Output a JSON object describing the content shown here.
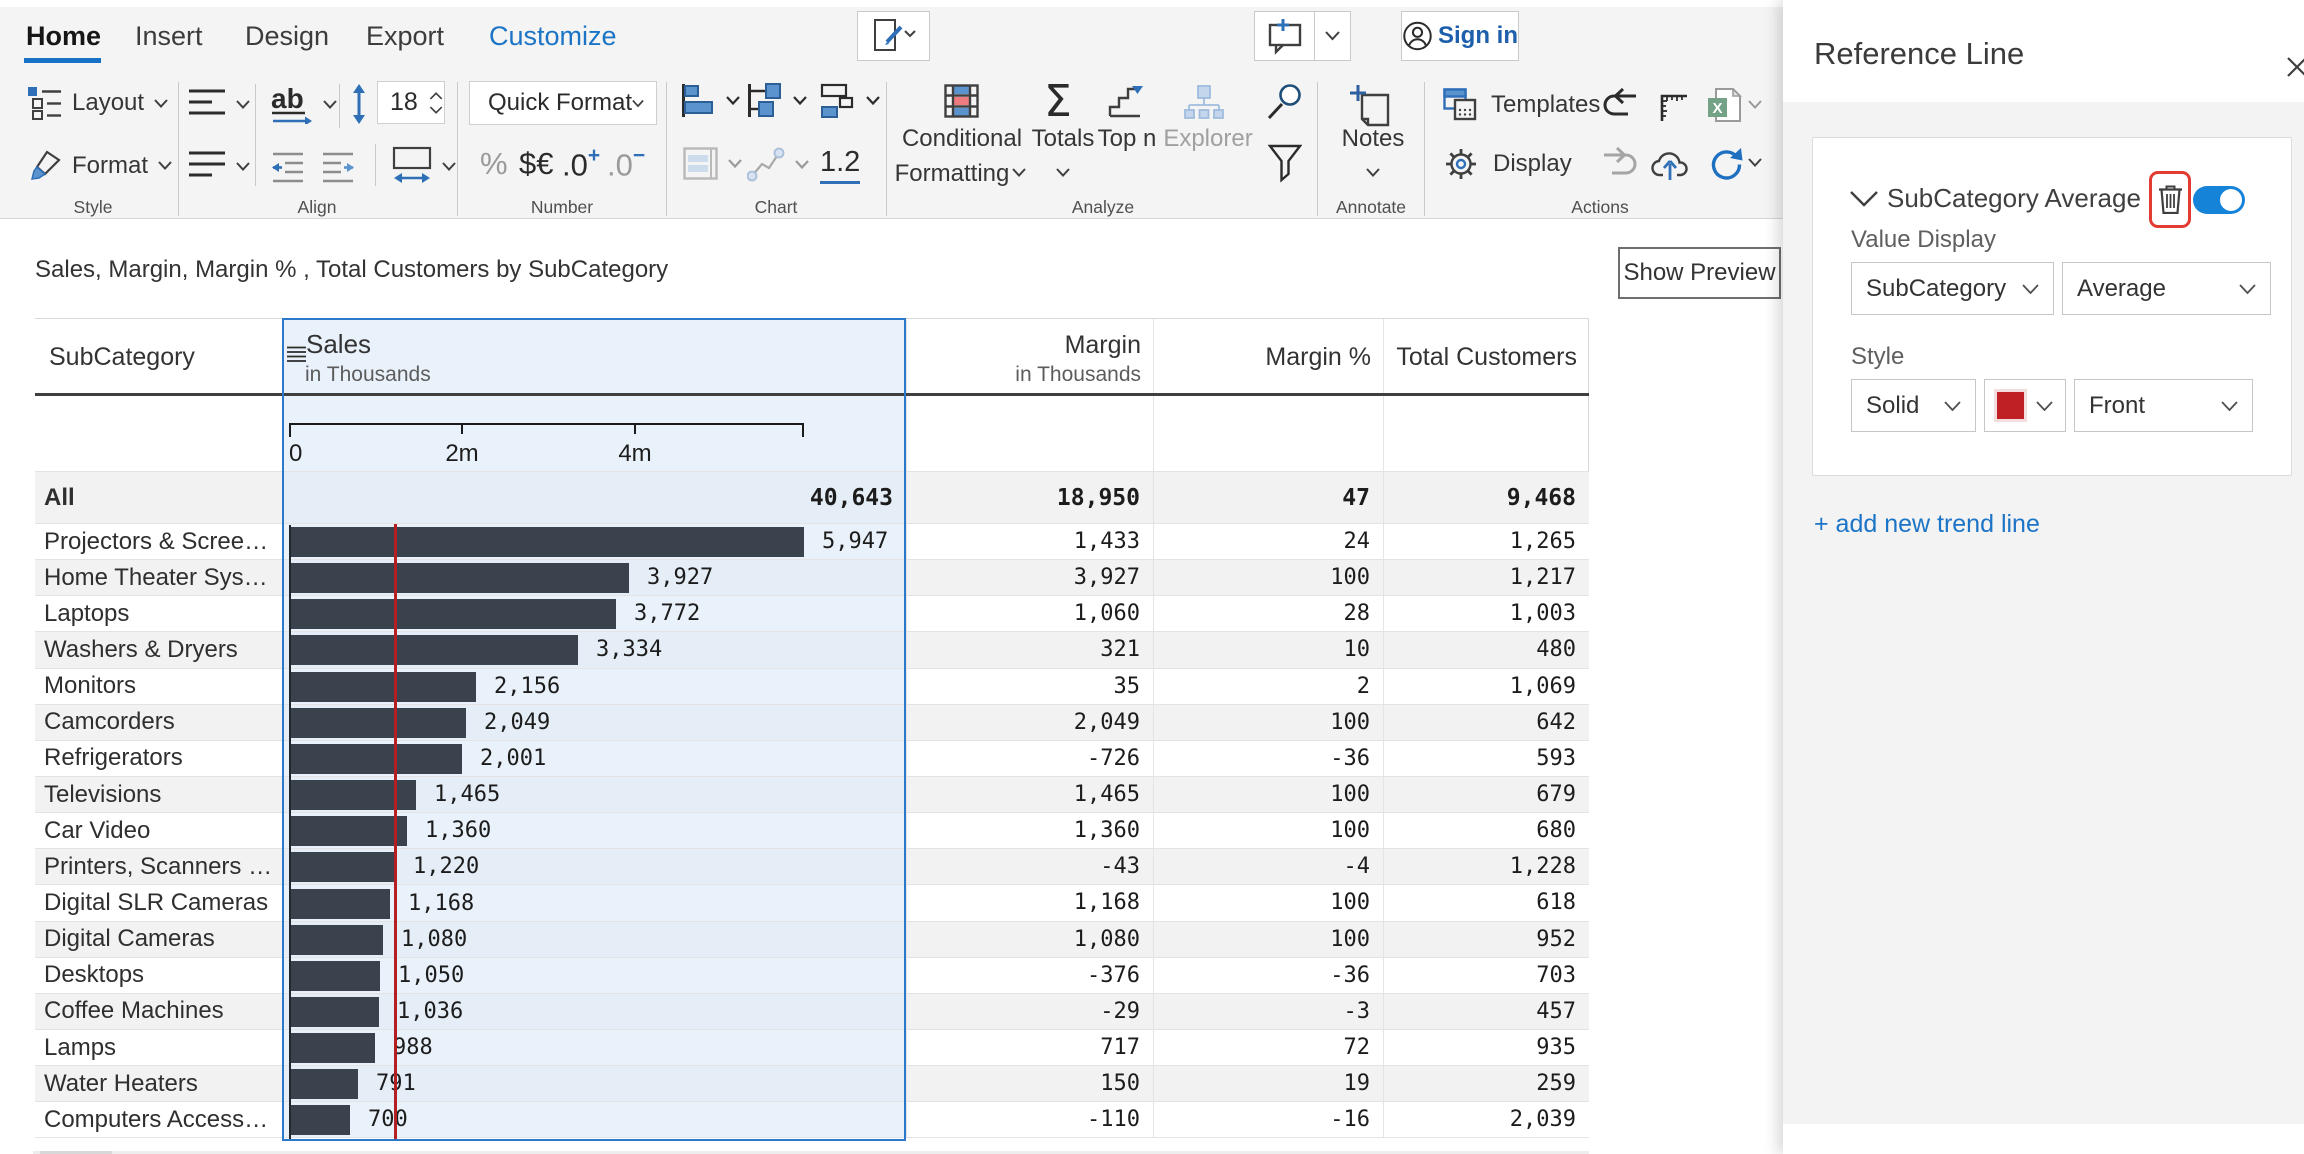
{
  "ribbon": {
    "tabs": [
      {
        "label": "Home",
        "active": true
      },
      {
        "label": "Insert"
      },
      {
        "label": "Design"
      },
      {
        "label": "Export"
      },
      {
        "label": "Customize",
        "highlighted": true
      }
    ],
    "sign_in": "Sign in",
    "style_group": {
      "label": "Style",
      "layout": "Layout",
      "format": "Format"
    },
    "align_group": {
      "label": "Align",
      "font_size": "18"
    },
    "number_group": {
      "label": "Number",
      "quick_format": "Quick Format",
      "percent": "%",
      "currency": "$€",
      "decimal_inc": ".0",
      "decimal_inc_sign": "+",
      "decimal_dec": ".0",
      "decimal_dec_sign": "−"
    },
    "chart_group": {
      "label": "Chart",
      "decimal_icon": "1.2"
    },
    "analyze_group": {
      "label": "Analyze",
      "conditional_line1": "Conditional",
      "conditional_line2": "Formatting",
      "totals": "Totals",
      "top_n": "Top n",
      "explorer": "Explorer"
    },
    "annotate_group": {
      "label": "Annotate",
      "notes": "Notes"
    },
    "actions_group": {
      "label": "Actions",
      "templates": "Templates",
      "display": "Display",
      "excel_letter": "X"
    }
  },
  "toolbar": {
    "title": "Sales, Margin, Margin % , Total Customers by SubCategory",
    "show_preview": "Show Preview"
  },
  "table": {
    "columns": [
      {
        "label": "SubCategory",
        "sub": ""
      },
      {
        "label": "Sales",
        "sub": "in Thousands"
      },
      {
        "label": "Margin",
        "sub": "in Thousands"
      },
      {
        "label": "Margin %",
        "sub": ""
      },
      {
        "label": "Total Customers",
        "sub": ""
      }
    ],
    "total_row": {
      "name": "All",
      "sales": "40,643",
      "margin": "18,950",
      "margin_pct": "47",
      "customers": "9,468"
    },
    "rows": [
      {
        "name": "Projectors & Scree…",
        "sales": "5,947",
        "margin": "1,433",
        "margin_pct": "24",
        "customers": "1,265"
      },
      {
        "name": "Home Theater Sys…",
        "sales": "3,927",
        "margin": "3,927",
        "margin_pct": "100",
        "customers": "1,217"
      },
      {
        "name": "Laptops",
        "sales": "3,772",
        "margin": "1,060",
        "margin_pct": "28",
        "customers": "1,003"
      },
      {
        "name": "Washers & Dryers",
        "sales": "3,334",
        "margin": "321",
        "margin_pct": "10",
        "customers": "480"
      },
      {
        "name": "Monitors",
        "sales": "2,156",
        "margin": "35",
        "margin_pct": "2",
        "customers": "1,069"
      },
      {
        "name": "Camcorders",
        "sales": "2,049",
        "margin": "2,049",
        "margin_pct": "100",
        "customers": "642"
      },
      {
        "name": "Refrigerators",
        "sales": "2,001",
        "margin": "-726",
        "margin_pct": "-36",
        "customers": "593"
      },
      {
        "name": "Televisions",
        "sales": "1,465",
        "margin": "1,465",
        "margin_pct": "100",
        "customers": "679"
      },
      {
        "name": "Car Video",
        "sales": "1,360",
        "margin": "1,360",
        "margin_pct": "100",
        "customers": "680"
      },
      {
        "name": "Printers, Scanners …",
        "sales": "1,220",
        "margin": "-43",
        "margin_pct": "-4",
        "customers": "1,228"
      },
      {
        "name": "Digital SLR Cameras",
        "sales": "1,168",
        "margin": "1,168",
        "margin_pct": "100",
        "customers": "618"
      },
      {
        "name": "Digital Cameras",
        "sales": "1,080",
        "margin": "1,080",
        "margin_pct": "100",
        "customers": "952"
      },
      {
        "name": "Desktops",
        "sales": "1,050",
        "margin": "-376",
        "margin_pct": "-36",
        "customers": "703"
      },
      {
        "name": "Coffee Machines",
        "sales": "1,036",
        "margin": "-29",
        "margin_pct": "-3",
        "customers": "457"
      },
      {
        "name": "Lamps",
        "sales": "988",
        "margin": "717",
        "margin_pct": "72",
        "customers": "935"
      },
      {
        "name": "Water Heaters",
        "sales": "791",
        "margin": "150",
        "margin_pct": "19",
        "customers": "259"
      },
      {
        "name": "Computers Access…",
        "sales": "700",
        "margin": "-110",
        "margin_pct": "-16",
        "customers": "2,039"
      }
    ]
  },
  "chart_data": {
    "type": "bar",
    "orientation": "horizontal",
    "title": "Sales, Margin, Margin % , Total Customers by SubCategory",
    "xlabel": "Sales in Thousands",
    "categories": [
      "Projectors & Scree…",
      "Home Theater Sys…",
      "Laptops",
      "Washers & Dryers",
      "Monitors",
      "Camcorders",
      "Refrigerators",
      "Televisions",
      "Car Video",
      "Printers, Scanners …",
      "Digital SLR Cameras",
      "Digital Cameras",
      "Desktops",
      "Coffee Machines",
      "Lamps",
      "Water Heaters",
      "Computers Access…"
    ],
    "values": [
      5947,
      3927,
      3772,
      3334,
      2156,
      2049,
      2001,
      1465,
      1360,
      1220,
      1168,
      1080,
      1050,
      1036,
      988,
      791,
      700
    ],
    "total": 40643,
    "xlim": [
      0,
      5947
    ],
    "axis_ticks": [
      "0",
      "2m",
      "4m"
    ],
    "axis_tick_values": [
      0,
      2000,
      4000
    ],
    "bar_color": "#3a424e",
    "reference_line": {
      "label": "SubCategory Average",
      "value": 1210,
      "color": "#b41f24",
      "style": "Solid",
      "position": "Front"
    }
  },
  "panel": {
    "title": "Reference Line",
    "card": {
      "name": "SubCategory Average",
      "enabled": true,
      "value_display_label": "Value Display",
      "dimension": "SubCategory",
      "aggregation": "Average",
      "style_label": "Style",
      "line_style": "Solid",
      "swatch_color": "#bf2026",
      "position": "Front"
    },
    "add_trend_line": "+ add new trend line"
  }
}
